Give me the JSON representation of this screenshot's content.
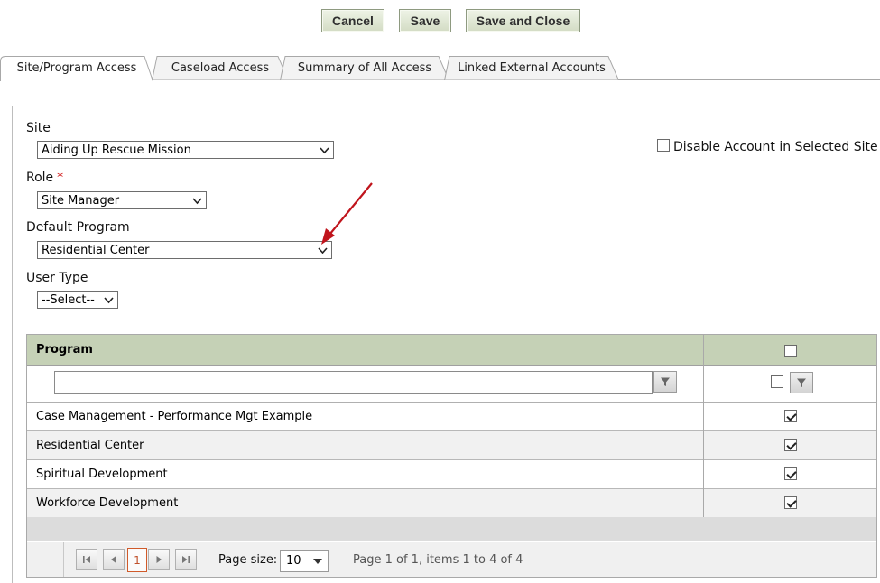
{
  "toolbar": {
    "cancel_label": "Cancel",
    "save_label": "Save",
    "save_close_label": "Save and Close"
  },
  "tabs": [
    {
      "label": "Site/Program Access",
      "active": true
    },
    {
      "label": "Caseload Access",
      "active": false
    },
    {
      "label": "Summary of All Access",
      "active": false
    },
    {
      "label": "Linked External Accounts",
      "active": false
    }
  ],
  "form": {
    "site": {
      "label": "Site",
      "value": "Aiding Up Rescue Mission"
    },
    "role": {
      "label": "Role",
      "required_mark": "*",
      "value": "Site Manager"
    },
    "default_program": {
      "label": "Default Program",
      "value": "Residential Center"
    },
    "user_type": {
      "label": "User Type",
      "value": "--Select--"
    },
    "disable_account": {
      "label": "Disable Account in Selected Site",
      "checked": false
    }
  },
  "grid": {
    "column_header": "Program",
    "filter_value": "",
    "header_checked": false,
    "filter_checked": false,
    "rows": [
      {
        "program": "Case Management - Performance Mgt Example",
        "checked": true
      },
      {
        "program": "Residential Center",
        "checked": true
      },
      {
        "program": "Spiritual Development",
        "checked": true
      },
      {
        "program": "Workforce Development",
        "checked": true
      }
    ],
    "pager": {
      "current_page": "1",
      "page_size_label": "Page size:",
      "page_size": "10",
      "info": "Page 1 of 1, items 1 to 4 of 4"
    }
  },
  "icons": {
    "filter": "filter-icon",
    "chevron": "chevron-down-icon",
    "first": "first-page-icon",
    "prev": "prev-page-icon",
    "next": "next-page-icon",
    "last": "last-page-icon",
    "annotation": "red-arrow-annotation"
  },
  "colors": {
    "grid_header": "#c5d1b6",
    "button_bg": "#d3dcc4",
    "required": "#cc0000",
    "annotation_arrow": "#c0141c",
    "current_page": "#c0502a"
  }
}
